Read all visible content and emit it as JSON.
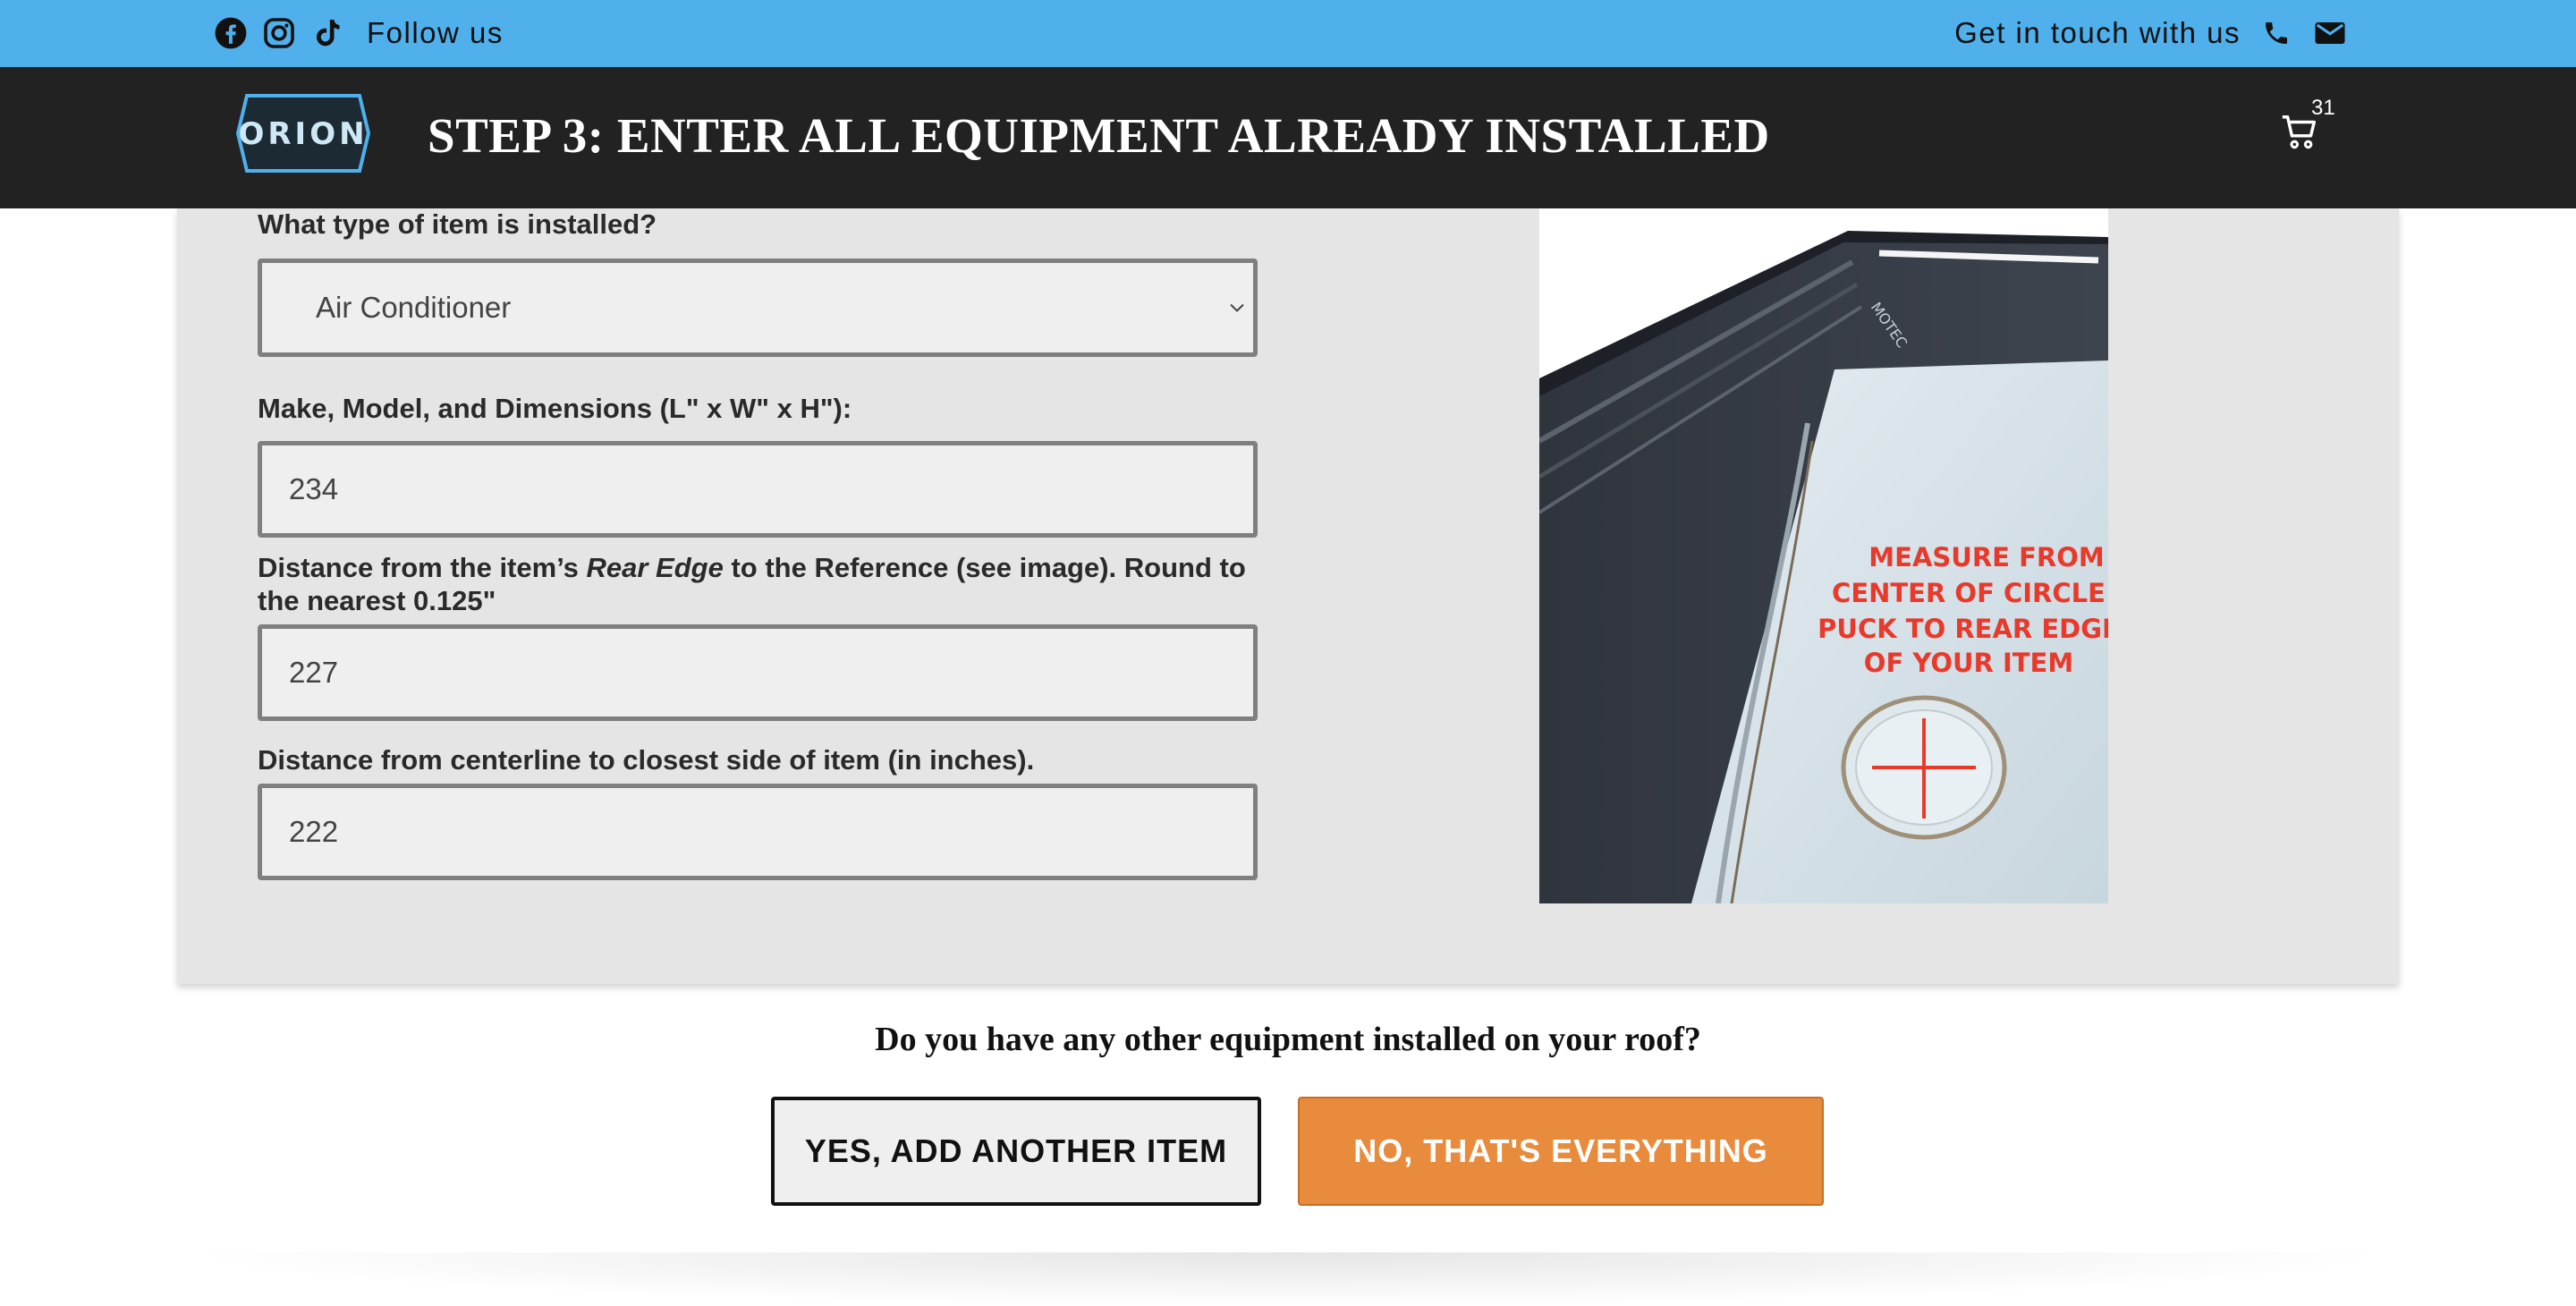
{
  "topbar": {
    "follow_label": "Follow us",
    "touch_label": "Get in touch with us",
    "social_icons": [
      "facebook-icon",
      "instagram-icon",
      "tiktok-icon"
    ],
    "contact_icons": [
      "phone-icon",
      "mail-icon"
    ],
    "background": "#4fb0ec"
  },
  "header": {
    "logo_text": "ORION",
    "title": "STEP 3: ENTER ALL EQUIPMENT ALREADY INSTALLED",
    "cart_count": "31",
    "background": "#222222"
  },
  "form": {
    "item_type": {
      "label": "What type of item is installed?",
      "selected": "Air Conditioner"
    },
    "make_model": {
      "label": "Make, Model, and Dimensions (L\" x W\" x H\"):",
      "value": "234"
    },
    "rear_edge": {
      "label_before": "Distance from the item’s ",
      "label_em": "Rear Edge",
      "label_after": " to the Reference (see image). Round to the nearest 0.125\"",
      "value": "227"
    },
    "centerline": {
      "label": "Distance from centerline to closest side of item (in inches).",
      "value": "222"
    },
    "image": {
      "caption_line1": "MEASURE FROM",
      "caption_line2": "CENTER OF CIRCLE",
      "caption_line3": "PUCK TO REAR EDGE",
      "caption_line4": "OF YOUR ITEM",
      "brand": "MOTEC"
    }
  },
  "question": "Do you have any other equipment installed on your roof?",
  "buttons": {
    "yes": "YES, ADD ANOTHER ITEM",
    "no": "NO, THAT'S EVERYTHING"
  },
  "colors": {
    "accent_orange": "#e88b3c",
    "caption_red": "#e8392a"
  }
}
